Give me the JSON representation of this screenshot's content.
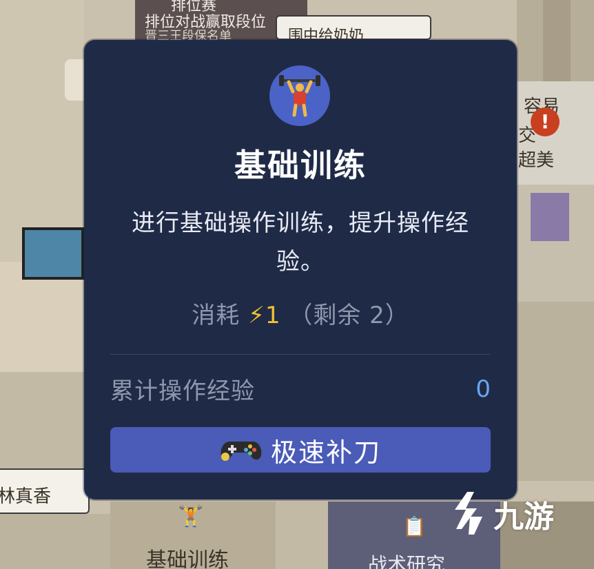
{
  "background": {
    "top_card_line1": "排位赛",
    "top_card_line2": "排位对战赢取段位",
    "top_card_line3": "晋三王段保名单",
    "grandma_card": "围中给奶奶",
    "right_card_1": "容易",
    "right_card_2": "交",
    "right_card_3": "超美",
    "left_card": "林真香",
    "bottom_card_1": "基础训练",
    "bottom_card_2": "战术研究",
    "alert_badge": "!"
  },
  "modal": {
    "icon": "weightlifter-icon",
    "title": "基础训练",
    "description": "进行基础操作训练，提升操作经验。",
    "cost_label": "消耗",
    "cost_icon": "lightning-icon",
    "cost_value": "1",
    "remaining": "（剩余 2）",
    "stat_label": "累计操作经验",
    "stat_value": "0",
    "button_icon": "gamepad-icon",
    "button_label": "极速补刀"
  },
  "watermark": {
    "text": "九游"
  },
  "colors": {
    "modal_bg": "#1f2a47",
    "button_bg": "#4a5bb8",
    "icon_circle": "#4b63c6",
    "accent_blue": "#6aa6f0",
    "energy_yellow": "#f2c230"
  }
}
